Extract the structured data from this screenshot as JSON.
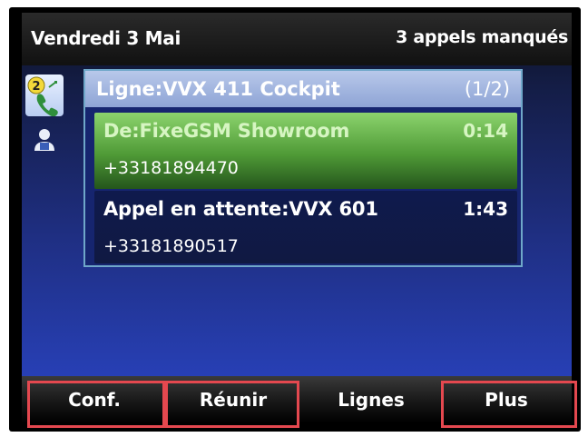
{
  "status_bar": {
    "date": "Vendredi 3 Mai",
    "missed_calls": "3 appels manqués"
  },
  "sidebar": {
    "lines_badge": "2",
    "lines_icon": "phone-line-icon",
    "contacts_icon": "person-icon"
  },
  "panel": {
    "line_title": "Ligne:VVX 411 Cockpit",
    "page": "(1/2)",
    "calls": [
      {
        "label": "De:FixeGSM Showroom",
        "timer": "0:14",
        "number": "+33181894470",
        "state": "active"
      },
      {
        "label": "Appel en attente:VVX 601",
        "timer": "1:43",
        "number": "+33181890517",
        "state": "held"
      }
    ]
  },
  "softkeys": [
    "Conf.",
    "Réunir",
    "Lignes",
    "Plus"
  ],
  "colors": {
    "active_call": "#5aa63f",
    "highlight": "#e4484f",
    "panel_border": "#6fa7c9"
  }
}
